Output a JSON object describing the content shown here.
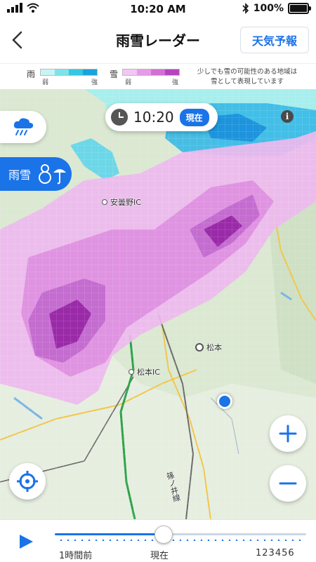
{
  "status_bar": {
    "time": "10:20 AM",
    "battery": "100%"
  },
  "header": {
    "title": "雨雪レーダー",
    "forecast_button": "天気予報"
  },
  "legend": {
    "rain_label": "雨",
    "snow_label": "雪",
    "rain_weak": "弱",
    "rain_strong": "強",
    "snow_weak": "弱",
    "snow_strong": "強",
    "note_line1": "少しでも雪の可能性のある地域は",
    "note_line2": "雪として表現しています",
    "rain_colors": [
      "#c9f4f4",
      "#7de3ea",
      "#35c7e3",
      "#1aa3dc",
      "#1b73e8"
    ],
    "snow_colors": [
      "#f3c6f3",
      "#e69be8",
      "#d46fd6",
      "#b843c0",
      "#8a1b94"
    ]
  },
  "map": {
    "current_time": "10:20",
    "now_badge": "現在",
    "info_icon": "i",
    "mode_label": "雨雪",
    "labels": {
      "azumino_ic": "安曇野IC",
      "matsumoto": "松本",
      "matsumoto_ic": "松本IC",
      "rail_line": "篠ノ井線"
    }
  },
  "timeline": {
    "past_label": "1時間前",
    "now_label": "現在",
    "forecast_label": "123456",
    "position_percent": 43
  }
}
